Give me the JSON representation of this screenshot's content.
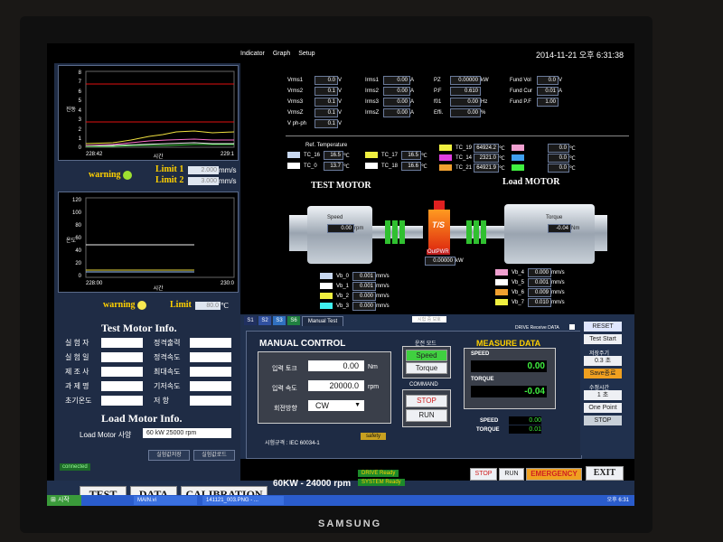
{
  "header": {
    "tabs": [
      "Indicator",
      "Graph",
      "Setup"
    ],
    "datetime": "2014-11-21 오후 6:31:38"
  },
  "left": {
    "chart1": {
      "y_ticks": [
        "8",
        "7",
        "6",
        "5",
        "4",
        "3",
        "2",
        "1",
        "0"
      ],
      "x_start": "228:42",
      "x_end": "229:1",
      "x_label": "시간",
      "y_label": "진동"
    },
    "warning_label": "warning",
    "limit1_label": "Limit 1",
    "limit2_label": "Limit 2",
    "limit1_value": "2.000",
    "limit2_value": "3.000",
    "vib_unit": "mm/s",
    "chart2": {
      "y_ticks": [
        "120",
        "100",
        "80",
        "60",
        "40",
        "20",
        "0"
      ],
      "x_start": "228:00",
      "x_end": "230:0",
      "x_label": "시간",
      "y_label": "온도"
    },
    "warning2_label": "warning",
    "limit_label": "Limit",
    "limit_value": "80.0",
    "temp_unit": "℃",
    "test_motor_title": "Test Motor Info.",
    "test_motor_fields_left": [
      "실 험 자",
      "실 험 일",
      "제 조 사",
      "과 제 명",
      "초기온도"
    ],
    "test_motor_fields_right": [
      "정격출력",
      "정격속도",
      "최대속도",
      "기저속도",
      "저    항"
    ],
    "load_motor_title": "Load Motor Info.",
    "load_motor_spec_label": "Load Motor 사양",
    "load_motor_spec_value": "60 kW 25000 rpm",
    "save_btn": "실험값저장",
    "load_btn": "실험값로드",
    "connected": "connected"
  },
  "measurements": {
    "vrms": [
      {
        "label": "Vrms1",
        "value": "0.0",
        "unit": "V"
      },
      {
        "label": "Vrms2",
        "value": "0.1",
        "unit": "V"
      },
      {
        "label": "Vrms3",
        "value": "0.1",
        "unit": "V"
      },
      {
        "label": "VrmsZ",
        "value": "0.1",
        "unit": "V"
      },
      {
        "label": "V ph-ph",
        "value": "0.1",
        "unit": "V"
      }
    ],
    "irms": [
      {
        "label": "Irms1",
        "value": "0.00",
        "unit": "A"
      },
      {
        "label": "Irms2",
        "value": "0.00",
        "unit": "A"
      },
      {
        "label": "Irms3",
        "value": "0.00",
        "unit": "A"
      },
      {
        "label": "IrmsZ",
        "value": "0.00",
        "unit": "A"
      }
    ],
    "power": [
      {
        "label": "PZ",
        "value": "0.00000",
        "unit": "kW"
      },
      {
        "label": "P.F",
        "value": "0.610",
        "unit": ""
      },
      {
        "label": "f01",
        "value": "0.00",
        "unit": "Hz"
      },
      {
        "label": "Effi.",
        "value": "0.00",
        "unit": "%"
      }
    ],
    "fund": [
      {
        "label": "Fund Vol",
        "value": "0.0",
        "unit": "V"
      },
      {
        "label": "Fund Cur",
        "value": "0.01",
        "unit": "A"
      },
      {
        "label": "Fund P.F",
        "value": "1.00",
        "unit": ""
      }
    ]
  },
  "temperature": {
    "title": "Ref. Temperature",
    "items": [
      {
        "label": "TC_16",
        "value": "16.5",
        "unit": "℃",
        "color": "#c8d8f0"
      },
      {
        "label": "TC_0",
        "value": "13.7",
        "unit": "℃",
        "color": "#ffffff"
      },
      {
        "label": "TC_17",
        "value": "16.5",
        "unit": "℃",
        "color": "#f0f040"
      },
      {
        "label": "TC_18",
        "value": "16.6",
        "unit": "℃",
        "color": "#ffffff"
      },
      {
        "label": "TC_19",
        "value": "64924.2",
        "unit": "℃",
        "color": "#f0f040"
      },
      {
        "label": "TC_14",
        "value": "2321.0",
        "unit": "℃",
        "color": "#e040e0"
      },
      {
        "label": "TC_21",
        "value": "64921.9",
        "unit": "℃",
        "color": "#f0a030"
      },
      {
        "label": "",
        "value": "0.0",
        "unit": "℃",
        "color": "#f0a0d0"
      },
      {
        "label": "",
        "value": "0.0",
        "unit": "℃",
        "color": "#40a0f0"
      },
      {
        "label": "",
        "value": "0.0",
        "unit": "℃",
        "color": "#40f040"
      }
    ]
  },
  "motors": {
    "test_motor": "TEST MOTOR",
    "load_motor": "Load MOTOR",
    "speed_label": "Speed",
    "speed_value": "0.00",
    "speed_unit": "rpm",
    "torque_label": "Torque",
    "torque_value": "-0.04",
    "torque_unit": "Nm",
    "ts_label": "T/S",
    "outpwr_label": "OutPWR",
    "outpwr_value": "0.00000",
    "outpwr_unit": "kW",
    "vib_left": [
      {
        "label": "Vb_0",
        "value": "0.001",
        "unit": "mm/s"
      },
      {
        "label": "Vb_1",
        "value": "0.001",
        "unit": "mm/s"
      },
      {
        "label": "Vb_2",
        "value": "0.000",
        "unit": "mm/s"
      },
      {
        "label": "Vb_3",
        "value": "0.000",
        "unit": "mm/s"
      }
    ],
    "vib_right": [
      {
        "label": "Vb_4",
        "value": "0.000",
        "unit": "mm/s"
      },
      {
        "label": "Vb_5",
        "value": "0.001",
        "unit": "mm/s"
      },
      {
        "label": "Vb_6",
        "value": "0.009",
        "unit": "mm/s"
      },
      {
        "label": "Vb_7",
        "value": "0.010",
        "unit": "mm/s"
      }
    ]
  },
  "bottom": {
    "tabs": [
      "S1",
      "S2",
      "S3",
      "S6",
      "Manual Test"
    ],
    "center_tag": "시험 중 보호",
    "drive_receive": "DRIVE Receive DATA",
    "manual_title": "MANUAL CONTROL",
    "input_torque_label": "입력 토크",
    "input_torque_value": "0.00",
    "input_torque_unit": "Nm",
    "input_speed_label": "입력 속도",
    "input_speed_value": "20000.0",
    "input_speed_unit": "rpm",
    "direction_label": "회전방향",
    "direction_value": "CW",
    "spec_label": "시험규격 : IEC 60034-1",
    "safety": "safety",
    "mode_label": "운전 모드",
    "speed_btn": "Speed",
    "torque_btn": "Torque",
    "command_label": "COMMAND",
    "stop_btn": "STOP",
    "run_btn": "RUN",
    "measure_title": "MEASURE DATA",
    "measure_speed_label": "SPEED",
    "measure_speed_value": "0.00",
    "measure_torque_label": "TORQUE",
    "measure_torque_value": "-0.04",
    "small_speed_label": "SPEED",
    "small_speed_value": "0.00",
    "small_torque_label": "TORQUE",
    "small_torque_value": "0.01"
  },
  "right_controls": {
    "reset": "RESET",
    "test_start": "Test Start",
    "save_period_label": "저장주기",
    "save_period_value": "0.3 초",
    "save_stop": "Save종료",
    "measure_time_label": "수정시간",
    "measure_time_value": "1 초",
    "one_point": "One Point",
    "stop": "STOP"
  },
  "footer": {
    "test": "TEST",
    "data": "DATA",
    "calibration": "CALIBRATION",
    "spec": "60KW - 24000 rpm",
    "drive_ready": "DRIVE Ready",
    "system_ready": "SYSTEM Ready",
    "stop": "STOP",
    "run": "RUN",
    "emergency": "EMERGENCY",
    "exit": "EXIT"
  },
  "taskbar": {
    "start": "시작",
    "items": [
      "MAIN.vi",
      "141121_003.PNG - ..."
    ],
    "time": "오후 6:31"
  },
  "brand": "SAMSUNG"
}
